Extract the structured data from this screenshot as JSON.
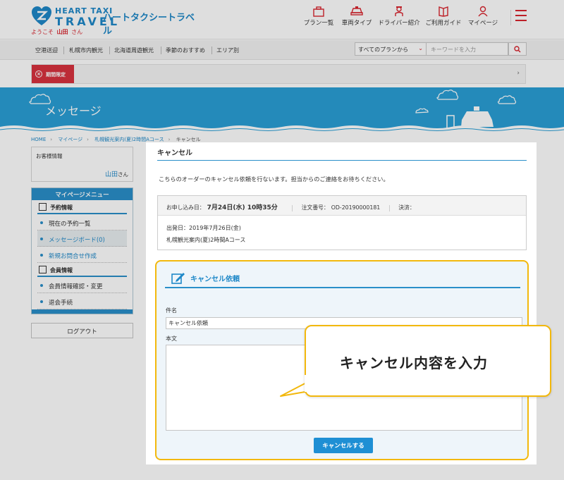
{
  "header": {
    "logo_en_line1": "HEART TAXI",
    "logo_en_line2": "TRAVEL",
    "logo_ja": "ハートタクシートラベル",
    "welcome_prefix": "ようこそ",
    "user_name": "山田",
    "welcome_suffix": "さん",
    "nav": [
      {
        "label": "プラン一覧",
        "icon": "suitcase-icon"
      },
      {
        "label": "車両タイプ",
        "icon": "car-icon"
      },
      {
        "label": "ドライバー紹介",
        "icon": "driver-icon"
      },
      {
        "label": "ご利用ガイド",
        "icon": "book-icon"
      },
      {
        "label": "マイページ",
        "icon": "person-icon"
      }
    ],
    "accent_color": "#d9252f",
    "brand_color": "#1e88c8"
  },
  "subnav": {
    "items": [
      "空港送迎",
      "札幌市内観光",
      "北海道周遊観光",
      "季節のおすすめ",
      "エリア別"
    ],
    "select_value": "すべてのプランから",
    "search_placeholder": "キーワードを入力"
  },
  "notice": {
    "badge": "期間限定"
  },
  "banner": {
    "title": "メッセージ"
  },
  "breadcrumb": [
    "HOME",
    "マイページ",
    "札幌観光案内(夏)2時間Aコース",
    "キャンセル"
  ],
  "sidebar": {
    "customer_label": "お客様情報",
    "customer_name": "山田",
    "customer_suffix": "さん",
    "menu_title": "マイページメニュー",
    "cat_reservation": "予約情報",
    "items_reservation": [
      "現在の予約一覧",
      "メッセージボード(0)",
      "新規お問合せ作成"
    ],
    "cat_member": "会員情報",
    "items_member": [
      "会員情報確認・変更",
      "退会手続"
    ],
    "logout": "ログアウト"
  },
  "main": {
    "title": "キャンセル",
    "intro": "こちらのオーダーのキャンセル依頼を行ないます。担当からのご連絡をお待ちください。",
    "order": {
      "date_label": "お申し込み日：",
      "date_value": "7月24日(水) 10時35分",
      "number_label": "注文番号：",
      "number_value": "OD-20190000181",
      "payment_label": "決済：",
      "departure": "出発日：2019年7月26日(金)",
      "course": "札幌観光案内(夏)2時間Aコース"
    },
    "form": {
      "title": "キャンセル依頼",
      "subject_label": "件名",
      "subject_value": "キャンセル依頼",
      "body_label": "本文",
      "body_value": "",
      "submit": "キャンセルする"
    }
  },
  "callout": {
    "text": "キャンセル内容を入力"
  }
}
